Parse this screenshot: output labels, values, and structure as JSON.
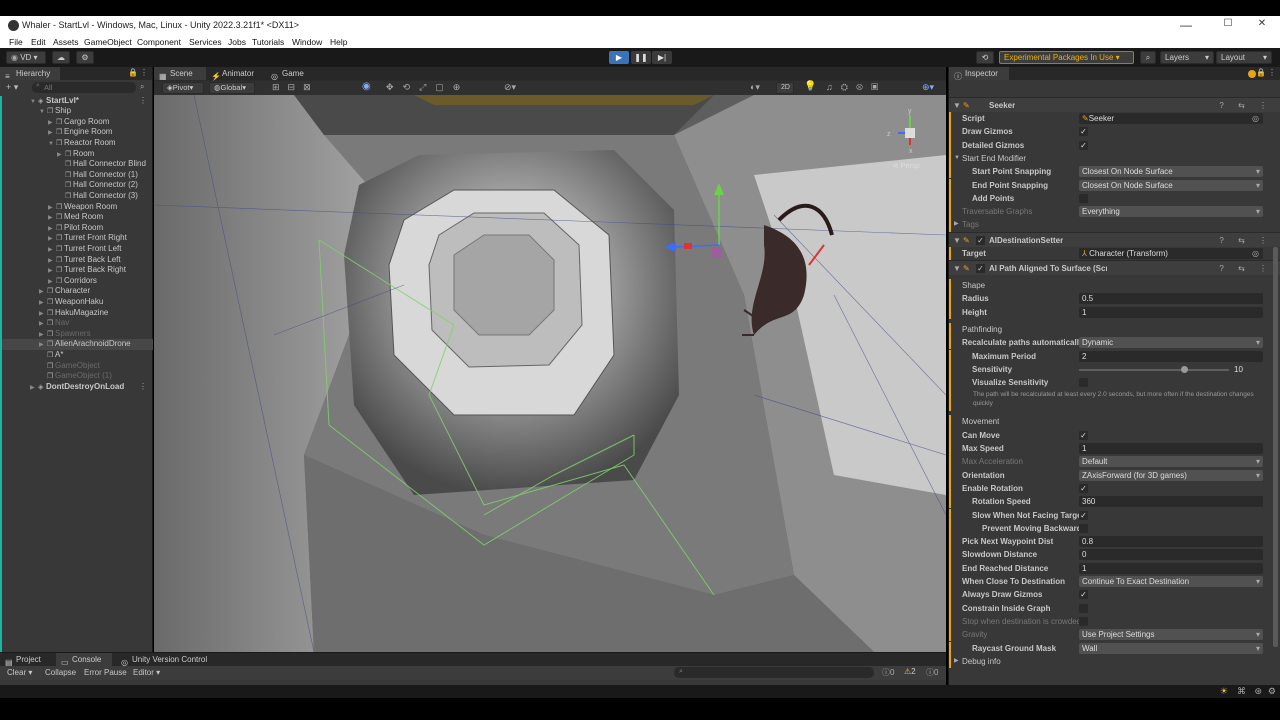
{
  "titlebar": {
    "title": "Whaler - StartLvl - Windows, Mac, Linux - Unity 2022.3.21f1* <DX11>",
    "min": "—",
    "max": "☐",
    "close": "✕"
  },
  "menu": [
    "File",
    "Edit",
    "Assets",
    "GameObject",
    "Component",
    "Services",
    "Jobs",
    "Tutorials",
    "Window",
    "Help"
  ],
  "toolbar": {
    "account": "VD",
    "experimental": "Experimental Packages In Use ▾",
    "layers": "Layers",
    "layout": "Layout"
  },
  "hierarchy": {
    "tab": "Hierarchy",
    "search_placeholder": "All",
    "rows": [
      {
        "label": "StartLvl*",
        "depth": 0,
        "arrow": "▼",
        "icon": "unity"
      },
      {
        "label": "Ship",
        "depth": 1,
        "arrow": "▼"
      },
      {
        "label": "Cargo Room",
        "depth": 2,
        "arrow": "▶"
      },
      {
        "label": "Engine Room",
        "depth": 2,
        "arrow": "▶"
      },
      {
        "label": "Reactor Room",
        "depth": 2,
        "arrow": "▼"
      },
      {
        "label": "Room",
        "depth": 3,
        "arrow": "▶"
      },
      {
        "label": "Hall Connector Blind",
        "depth": 3,
        "arrow": ""
      },
      {
        "label": "Hall Connector (1)",
        "depth": 3,
        "arrow": ""
      },
      {
        "label": "Hall Connector (2)",
        "depth": 3,
        "arrow": ""
      },
      {
        "label": "Hall Connector (3)",
        "depth": 3,
        "arrow": ""
      },
      {
        "label": "Weapon Room",
        "depth": 2,
        "arrow": "▶"
      },
      {
        "label": "Med Room",
        "depth": 2,
        "arrow": "▶"
      },
      {
        "label": "Pilot Room",
        "depth": 2,
        "arrow": "▶"
      },
      {
        "label": "Turret Front Right",
        "depth": 2,
        "arrow": "▶"
      },
      {
        "label": "Turret Front Left",
        "depth": 2,
        "arrow": "▶"
      },
      {
        "label": "Turret Back Left",
        "depth": 2,
        "arrow": "▶"
      },
      {
        "label": "Turret Back Right",
        "depth": 2,
        "arrow": "▶"
      },
      {
        "label": "Corridors",
        "depth": 2,
        "arrow": "▶"
      },
      {
        "label": "Character",
        "depth": 1,
        "arrow": "▶"
      },
      {
        "label": "WeaponHaku",
        "depth": 1,
        "arrow": "▶"
      },
      {
        "label": "HakuMagazine",
        "depth": 1,
        "arrow": "▶"
      },
      {
        "label": "Nav",
        "depth": 1,
        "arrow": "▶",
        "dim": true
      },
      {
        "label": "Spawners",
        "depth": 1,
        "arrow": "▶",
        "dim": true
      },
      {
        "label": "AlienArachnoidDrone",
        "depth": 1,
        "arrow": "▶",
        "sel": true
      },
      {
        "label": "A*",
        "depth": 1,
        "arrow": ""
      },
      {
        "label": "GameObject",
        "depth": 1,
        "arrow": "",
        "dim": true
      },
      {
        "label": "GameObject (1)",
        "depth": 1,
        "arrow": "",
        "dim": true
      },
      {
        "label": "DontDestroyOnLoad",
        "depth": 0,
        "arrow": "▶",
        "icon": "unity"
      }
    ]
  },
  "scene_tabs": {
    "scene": "Scene",
    "animator": "Animator",
    "game": "Game"
  },
  "scene_toolbar": {
    "pivot": "Pivot",
    "global": "Global",
    "mode2d": "2D",
    "persp": "Persp"
  },
  "inspector": {
    "tab": "Inspector",
    "rows": [
      {
        "type": "header",
        "label": "Seeker",
        "icons": "? ⇆ ⋮"
      },
      {
        "type": "field",
        "label": "Script",
        "value": "Seeker",
        "style": "obj"
      },
      {
        "type": "check",
        "label": "Draw Gizmos",
        "value": "✓"
      },
      {
        "type": "check",
        "label": "Detailed Gizmos",
        "value": "✓"
      },
      {
        "type": "fold",
        "label": "Start End Modifier",
        "arrow": "▼"
      },
      {
        "type": "dd",
        "label": "Start Point Snapping",
        "value": "Closest On Node Surface",
        "indent": 1
      },
      {
        "type": "dd",
        "label": "End Point Snapping",
        "value": "Closest On Node Surface",
        "indent": 1
      },
      {
        "type": "check",
        "label": "Add Points",
        "value": "",
        "indent": 1
      },
      {
        "type": "dd",
        "label": "Traversable Graphs",
        "value": "Everything",
        "dim": true
      },
      {
        "type": "fold",
        "label": "Tags",
        "arrow": "▶",
        "dim": true
      },
      {
        "type": "header",
        "label": "AIDestinationSetter",
        "icons": "? ⇆ ⋮",
        "check": "✓"
      },
      {
        "type": "obj",
        "label": "Target",
        "value": "Character (Transform)"
      },
      {
        "type": "header",
        "label": "AI Path Aligned To Surface (Script)",
        "icons": "? ⇆ ⋮",
        "check": "✓"
      },
      {
        "type": "section",
        "label": "Shape"
      },
      {
        "type": "text",
        "label": "Radius",
        "value": "0.5"
      },
      {
        "type": "text",
        "label": "Height",
        "value": "1"
      },
      {
        "type": "section",
        "label": "Pathfinding"
      },
      {
        "type": "dd",
        "label": "Recalculate paths automaticall",
        "value": "Dynamic"
      },
      {
        "type": "text",
        "label": "Maximum Period",
        "value": "2",
        "indent": 1
      },
      {
        "type": "slider",
        "label": "Sensitivity",
        "value": "10",
        "fraction": 0.7,
        "indent": 1
      },
      {
        "type": "check",
        "label": "Visualize Sensitivity",
        "value": "",
        "indent": 1
      },
      {
        "type": "note",
        "label": "The path will be recalculated at least every 2.0 seconds, but more often if the destination changes quickly"
      },
      {
        "type": "section",
        "label": "Movement"
      },
      {
        "type": "check",
        "label": "Can Move",
        "value": "✓"
      },
      {
        "type": "text",
        "label": "Max Speed",
        "value": "1"
      },
      {
        "type": "dd",
        "label": "Max Acceleration",
        "value": "Default",
        "dim": true
      },
      {
        "type": "dd",
        "label": "Orientation",
        "value": "ZAxisForward (for 3D games)"
      },
      {
        "type": "check",
        "label": "Enable Rotation",
        "value": "✓"
      },
      {
        "type": "text",
        "label": "Rotation Speed",
        "value": "360",
        "indent": 1
      },
      {
        "type": "check",
        "label": "Slow When Not Facing Target",
        "value": "✓",
        "indent": 1
      },
      {
        "type": "check",
        "label": "Prevent Moving Backwards",
        "value": "",
        "indent": 2
      },
      {
        "type": "text",
        "label": "Pick Next Waypoint Dist",
        "value": "0.8"
      },
      {
        "type": "text",
        "label": "Slowdown Distance",
        "value": "0"
      },
      {
        "type": "text",
        "label": "End Reached Distance",
        "value": "1"
      },
      {
        "type": "dd",
        "label": "When Close To Destination",
        "value": "Continue To Exact Destination"
      },
      {
        "type": "check",
        "label": "Always Draw Gizmos",
        "value": "✓"
      },
      {
        "type": "check",
        "label": "Constrain Inside Graph",
        "value": ""
      },
      {
        "type": "check",
        "label": "Stop when destination is crowded",
        "value": "",
        "dim": true
      },
      {
        "type": "dd",
        "label": "Gravity",
        "value": "Use Project Settings",
        "dim": true
      },
      {
        "type": "dd",
        "label": "Raycast Ground Mask",
        "value": "Wall",
        "indent": 1
      },
      {
        "type": "fold",
        "label": "Debug info",
        "arrow": "▶"
      }
    ]
  },
  "bottom": {
    "tabs": [
      "Project",
      "Console",
      "Unity Version Control"
    ],
    "clear": "Clear",
    "collapse": "Collapse",
    "error_pause": "Error Pause",
    "editor": "Editor",
    "counts": {
      "log": "0",
      "warn": "2",
      "error": "0"
    }
  },
  "colors": {
    "accent": "#e8a417",
    "selection": "#474747",
    "panel": "#383838",
    "navmesh": "#7fd16a"
  }
}
